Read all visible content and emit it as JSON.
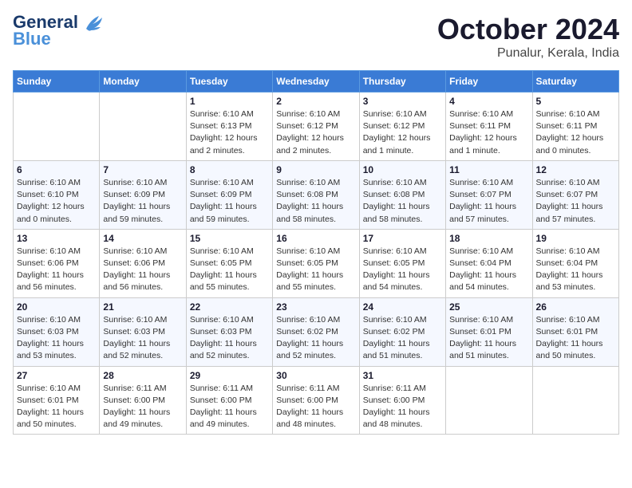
{
  "logo": {
    "line1": "General",
    "line2": "Blue"
  },
  "title": "October 2024",
  "subtitle": "Punalur, Kerala, India",
  "days_of_week": [
    "Sunday",
    "Monday",
    "Tuesday",
    "Wednesday",
    "Thursday",
    "Friday",
    "Saturday"
  ],
  "weeks": [
    [
      {
        "day": "",
        "info": ""
      },
      {
        "day": "",
        "info": ""
      },
      {
        "day": "1",
        "info": "Sunrise: 6:10 AM\nSunset: 6:13 PM\nDaylight: 12 hours\nand 2 minutes."
      },
      {
        "day": "2",
        "info": "Sunrise: 6:10 AM\nSunset: 6:12 PM\nDaylight: 12 hours\nand 2 minutes."
      },
      {
        "day": "3",
        "info": "Sunrise: 6:10 AM\nSunset: 6:12 PM\nDaylight: 12 hours\nand 1 minute."
      },
      {
        "day": "4",
        "info": "Sunrise: 6:10 AM\nSunset: 6:11 PM\nDaylight: 12 hours\nand 1 minute."
      },
      {
        "day": "5",
        "info": "Sunrise: 6:10 AM\nSunset: 6:11 PM\nDaylight: 12 hours\nand 0 minutes."
      }
    ],
    [
      {
        "day": "6",
        "info": "Sunrise: 6:10 AM\nSunset: 6:10 PM\nDaylight: 12 hours\nand 0 minutes."
      },
      {
        "day": "7",
        "info": "Sunrise: 6:10 AM\nSunset: 6:09 PM\nDaylight: 11 hours\nand 59 minutes."
      },
      {
        "day": "8",
        "info": "Sunrise: 6:10 AM\nSunset: 6:09 PM\nDaylight: 11 hours\nand 59 minutes."
      },
      {
        "day": "9",
        "info": "Sunrise: 6:10 AM\nSunset: 6:08 PM\nDaylight: 11 hours\nand 58 minutes."
      },
      {
        "day": "10",
        "info": "Sunrise: 6:10 AM\nSunset: 6:08 PM\nDaylight: 11 hours\nand 58 minutes."
      },
      {
        "day": "11",
        "info": "Sunrise: 6:10 AM\nSunset: 6:07 PM\nDaylight: 11 hours\nand 57 minutes."
      },
      {
        "day": "12",
        "info": "Sunrise: 6:10 AM\nSunset: 6:07 PM\nDaylight: 11 hours\nand 57 minutes."
      }
    ],
    [
      {
        "day": "13",
        "info": "Sunrise: 6:10 AM\nSunset: 6:06 PM\nDaylight: 11 hours\nand 56 minutes."
      },
      {
        "day": "14",
        "info": "Sunrise: 6:10 AM\nSunset: 6:06 PM\nDaylight: 11 hours\nand 56 minutes."
      },
      {
        "day": "15",
        "info": "Sunrise: 6:10 AM\nSunset: 6:05 PM\nDaylight: 11 hours\nand 55 minutes."
      },
      {
        "day": "16",
        "info": "Sunrise: 6:10 AM\nSunset: 6:05 PM\nDaylight: 11 hours\nand 55 minutes."
      },
      {
        "day": "17",
        "info": "Sunrise: 6:10 AM\nSunset: 6:05 PM\nDaylight: 11 hours\nand 54 minutes."
      },
      {
        "day": "18",
        "info": "Sunrise: 6:10 AM\nSunset: 6:04 PM\nDaylight: 11 hours\nand 54 minutes."
      },
      {
        "day": "19",
        "info": "Sunrise: 6:10 AM\nSunset: 6:04 PM\nDaylight: 11 hours\nand 53 minutes."
      }
    ],
    [
      {
        "day": "20",
        "info": "Sunrise: 6:10 AM\nSunset: 6:03 PM\nDaylight: 11 hours\nand 53 minutes."
      },
      {
        "day": "21",
        "info": "Sunrise: 6:10 AM\nSunset: 6:03 PM\nDaylight: 11 hours\nand 52 minutes."
      },
      {
        "day": "22",
        "info": "Sunrise: 6:10 AM\nSunset: 6:03 PM\nDaylight: 11 hours\nand 52 minutes."
      },
      {
        "day": "23",
        "info": "Sunrise: 6:10 AM\nSunset: 6:02 PM\nDaylight: 11 hours\nand 52 minutes."
      },
      {
        "day": "24",
        "info": "Sunrise: 6:10 AM\nSunset: 6:02 PM\nDaylight: 11 hours\nand 51 minutes."
      },
      {
        "day": "25",
        "info": "Sunrise: 6:10 AM\nSunset: 6:01 PM\nDaylight: 11 hours\nand 51 minutes."
      },
      {
        "day": "26",
        "info": "Sunrise: 6:10 AM\nSunset: 6:01 PM\nDaylight: 11 hours\nand 50 minutes."
      }
    ],
    [
      {
        "day": "27",
        "info": "Sunrise: 6:10 AM\nSunset: 6:01 PM\nDaylight: 11 hours\nand 50 minutes."
      },
      {
        "day": "28",
        "info": "Sunrise: 6:11 AM\nSunset: 6:00 PM\nDaylight: 11 hours\nand 49 minutes."
      },
      {
        "day": "29",
        "info": "Sunrise: 6:11 AM\nSunset: 6:00 PM\nDaylight: 11 hours\nand 49 minutes."
      },
      {
        "day": "30",
        "info": "Sunrise: 6:11 AM\nSunset: 6:00 PM\nDaylight: 11 hours\nand 48 minutes."
      },
      {
        "day": "31",
        "info": "Sunrise: 6:11 AM\nSunset: 6:00 PM\nDaylight: 11 hours\nand 48 minutes."
      },
      {
        "day": "",
        "info": ""
      },
      {
        "day": "",
        "info": ""
      }
    ]
  ]
}
